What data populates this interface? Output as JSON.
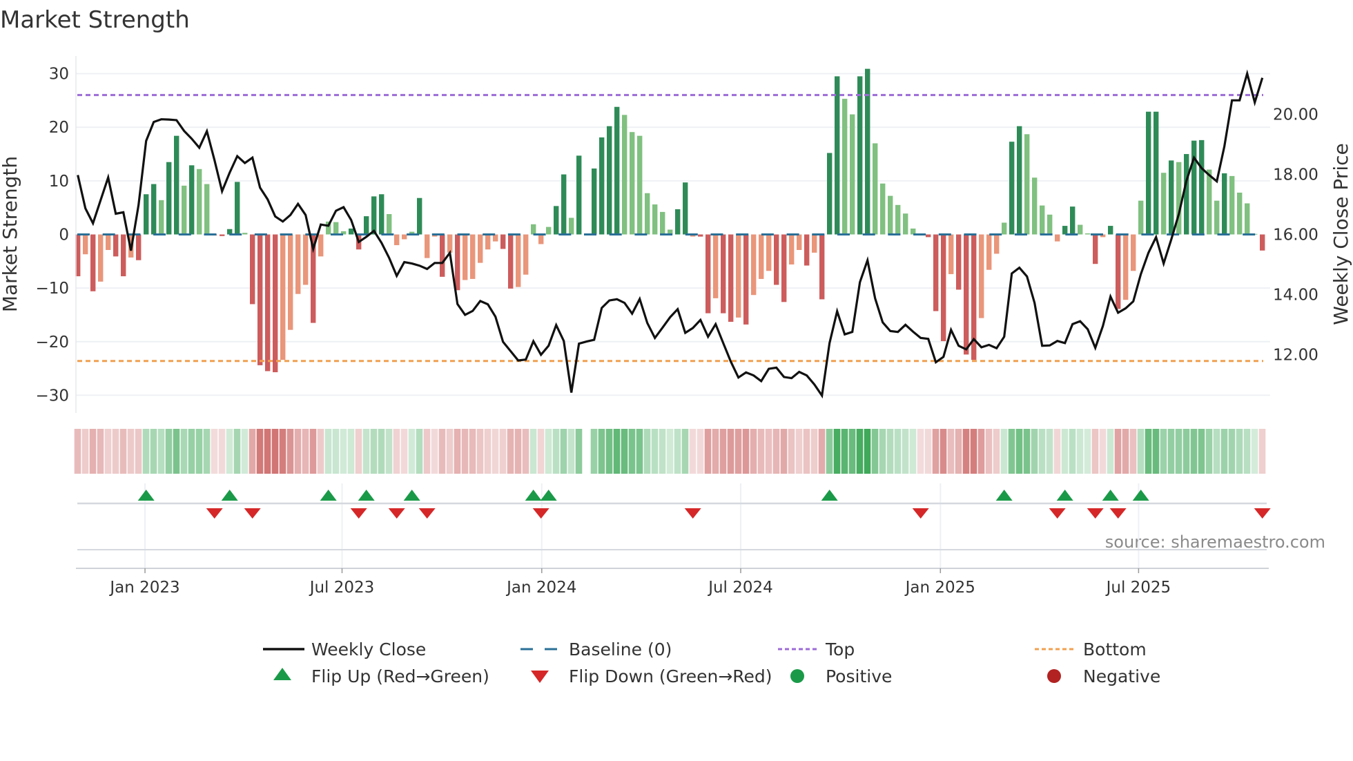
{
  "chart_data": {
    "type": "bar",
    "title": "Market Strength",
    "ylabel": "Market Strength",
    "y2label": "Weekly Close Price",
    "ylim": [
      -33.3,
      33.3
    ],
    "y2lim": [
      10.05,
      21.95
    ],
    "yticks": [
      {
        "v": 30,
        "label": "30"
      },
      {
        "v": 20,
        "label": "20"
      },
      {
        "v": 10,
        "label": "10"
      },
      {
        "v": 0,
        "label": "0"
      },
      {
        "v": -10,
        "label": "−10"
      },
      {
        "v": -20,
        "label": "−20"
      },
      {
        "v": -30,
        "label": "−30"
      }
    ],
    "y2ticks": [
      {
        "v": 12,
        "label": "12.00"
      },
      {
        "v": 14,
        "label": "14.00"
      },
      {
        "v": 16,
        "label": "16.00"
      },
      {
        "v": 18,
        "label": "18.00"
      },
      {
        "v": 20,
        "label": "20.00"
      }
    ],
    "x_unit": "week index",
    "xticks": [
      {
        "week": 8.85,
        "label": "Jan 2023"
      },
      {
        "week": 34.8,
        "label": "Jul 2023"
      },
      {
        "week": 61.1,
        "label": "Jan 2024"
      },
      {
        "week": 87.3,
        "label": "Jul 2024"
      },
      {
        "week": 113.6,
        "label": "Jan 2025"
      },
      {
        "week": 139.7,
        "label": "Jul 2025"
      }
    ],
    "grid": true,
    "top_level": 26,
    "bottom_level": -23.6,
    "baseline": 0,
    "strength": [
      -7.8,
      -3.7,
      -10.6,
      -8.8,
      -2.9,
      -4.1,
      -7.8,
      -4.3,
      -4.8,
      7.5,
      9.4,
      6.4,
      13.5,
      18.4,
      9.1,
      12.9,
      12.2,
      9.4,
      -0.2,
      -0.3,
      1.0,
      9.8,
      0.3,
      -13.0,
      -24.4,
      -25.5,
      -25.7,
      -23.4,
      -17.8,
      -11.1,
      -9.4,
      -16.5,
      -4.1,
      2.4,
      2.3,
      0.6,
      1.1,
      -2.8,
      3.4,
      7.1,
      7.5,
      3.8,
      -2.0,
      -0.9,
      0.5,
      6.8,
      -4.4,
      -0.4,
      -7.9,
      -3.4,
      -10.4,
      -8.5,
      -8.3,
      -5.3,
      -2.8,
      -1.3,
      -2.7,
      -10.1,
      -9.8,
      -7.5,
      1.9,
      -1.8,
      1.4,
      5.3,
      11.2,
      3.1,
      14.7,
      0,
      12.3,
      18.1,
      20.2,
      23.8,
      22.3,
      19.1,
      18.4,
      7.7,
      5.6,
      4.2,
      0.9,
      4.7,
      9.7,
      -0.4,
      -0.4,
      -14.7,
      -11.9,
      -14.7,
      -16.3,
      -15.5,
      -16.8,
      -11.3,
      -8.3,
      -6.8,
      -9.4,
      -12.6,
      -5.6,
      -2.9,
      -5.8,
      -3.4,
      -12.1,
      15.2,
      29.5,
      25.3,
      22.4,
      29.5,
      30.9,
      17.0,
      9.5,
      7.2,
      5.5,
      3.9,
      1.1,
      -0.2,
      -0.5,
      -14.3,
      -19.9,
      -7.4,
      -10.3,
      -22.4,
      -23.4,
      -15.6,
      -6.6,
      -3.6,
      2.2,
      17.3,
      20.2,
      18.7,
      10.6,
      5.4,
      3.7,
      -1.3,
      1.6,
      5.2,
      1.8,
      0.2,
      -5.5,
      -0.5,
      1.6,
      -13.9,
      -12.2,
      -6.8,
      6.3,
      22.9,
      22.9,
      11.5,
      13.8,
      13.5,
      15.0,
      17.5,
      17.6,
      12.1,
      6.3,
      11.4,
      10.9,
      7.8,
      5.8,
      0.1,
      -3.0
    ],
    "weekly_close": [
      17.98,
      16.87,
      16.37,
      17.14,
      17.9,
      16.69,
      16.74,
      15.46,
      16.98,
      19.12,
      19.75,
      19.84,
      19.83,
      19.81,
      19.45,
      19.19,
      18.89,
      19.44,
      18.48,
      17.44,
      18.06,
      18.61,
      18.38,
      18.56,
      17.56,
      17.17,
      16.6,
      16.43,
      16.65,
      17.02,
      16.65,
      15.52,
      16.33,
      16.29,
      16.79,
      16.91,
      16.48,
      15.75,
      15.92,
      16.12,
      15.72,
      15.22,
      14.62,
      15.08,
      15.03,
      14.96,
      14.85,
      15.05,
      15.05,
      15.39,
      13.68,
      13.32,
      13.45,
      13.78,
      13.67,
      13.26,
      12.42,
      12.11,
      11.8,
      11.83,
      12.44,
      11.99,
      12.29,
      12.98,
      12.45,
      10.73,
      12.36,
      12.43,
      12.49,
      13.55,
      13.8,
      13.84,
      13.72,
      13.36,
      13.85,
      13.05,
      12.55,
      12.89,
      13.24,
      13.51,
      12.72,
      12.88,
      13.15,
      12.59,
      13.01,
      12.38,
      11.76,
      11.23,
      11.4,
      11.3,
      11.11,
      11.52,
      11.56,
      11.25,
      11.21,
      11.42,
      11.3,
      11.0,
      10.63,
      12.38,
      13.44,
      12.67,
      12.75,
      14.41,
      15.14,
      13.87,
      13.07,
      12.78,
      12.75,
      12.99,
      12.76,
      12.55,
      12.52,
      11.74,
      11.92,
      12.82,
      12.29,
      12.17,
      12.51,
      12.24,
      12.32,
      12.21,
      12.59,
      14.7,
      14.89,
      14.6,
      13.72,
      12.29,
      12.3,
      12.45,
      12.38,
      13.01,
      13.11,
      12.84,
      12.22,
      12.95,
      13.93,
      13.39,
      13.54,
      13.77,
      14.68,
      15.39,
      15.91,
      15.03,
      15.83,
      16.68,
      17.79,
      18.56,
      18.21,
      17.98,
      17.77,
      18.94,
      20.47,
      20.47,
      21.36,
      20.4,
      21.22
    ],
    "colors": {
      "positive_strong": "#2e8b57",
      "positive_weak": "#80c080",
      "negative_strong": "#cd5c5c",
      "negative_weak": "#e9967a",
      "strip_positive": "#3aa655",
      "strip_negative": "#c85a5a",
      "line": "#111111",
      "baseline": "#2a6f97",
      "top": "#9b6bd6",
      "bottom": "#f0a050",
      "flip_up": "#1a9a48",
      "flip_down": "#d62728"
    },
    "legend": {
      "placement": "bottom",
      "items": [
        {
          "key": "line",
          "label": "Weekly Close"
        },
        {
          "key": "baseline",
          "label": "Baseline (0)"
        },
        {
          "key": "top",
          "label": "Top"
        },
        {
          "key": "bottom",
          "label": "Bottom"
        },
        {
          "key": "flip_up",
          "label": "Flip Up (Red→Green)"
        },
        {
          "key": "flip_down",
          "label": "Flip Down (Green→Red)"
        },
        {
          "key": "positive",
          "label": "Positive"
        },
        {
          "key": "negative",
          "label": "Negative"
        }
      ]
    },
    "source": "source: sharemaestro.com"
  }
}
